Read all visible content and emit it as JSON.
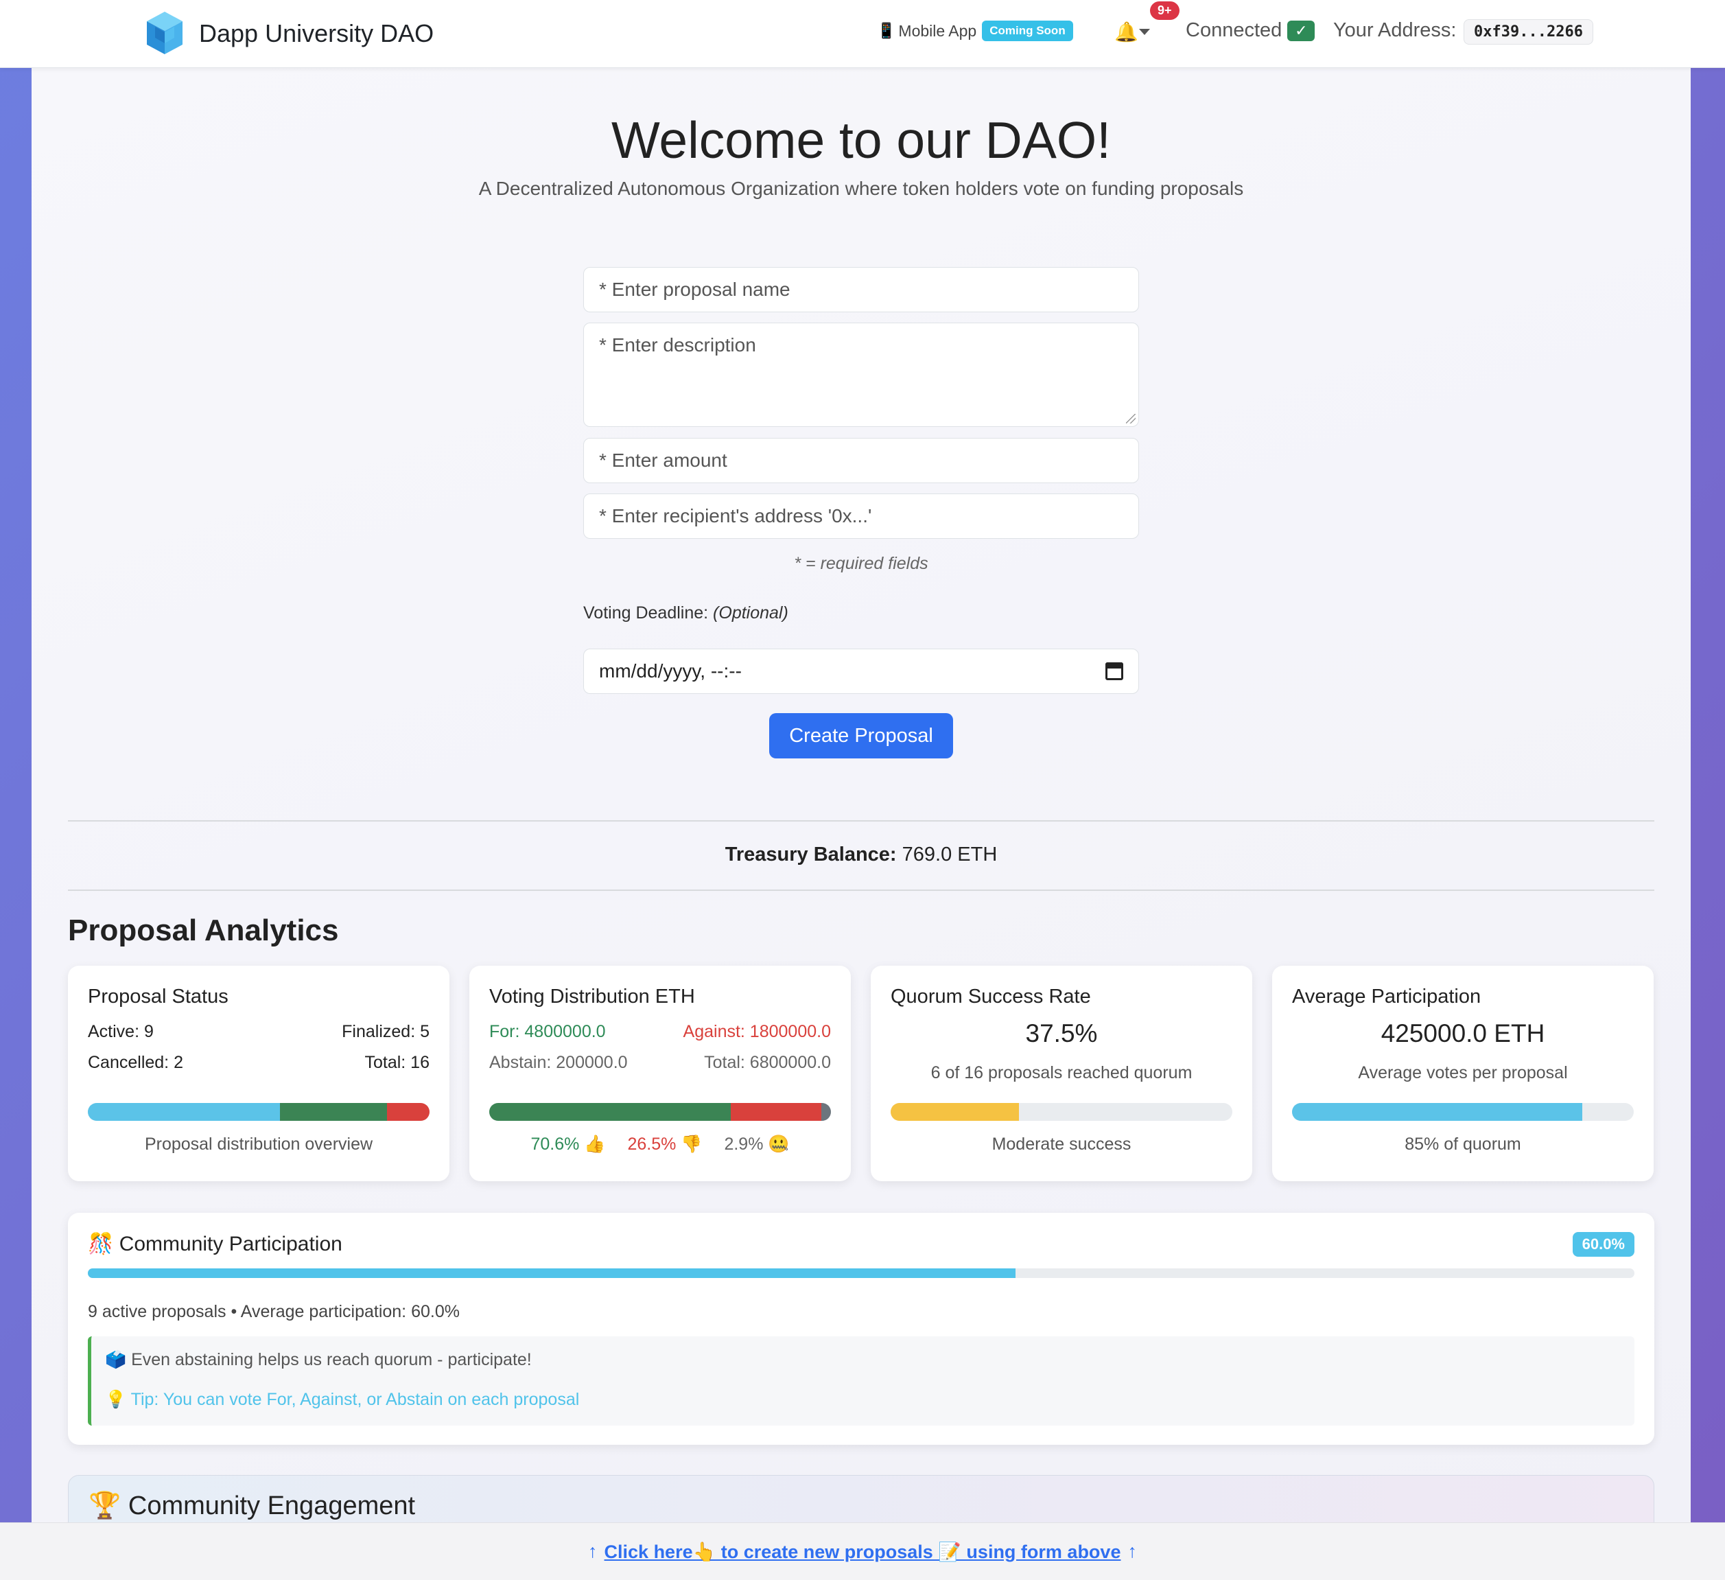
{
  "nav": {
    "brand": "Dapp University DAO",
    "mobile_app": "Mobile App",
    "coming_soon": "Coming Soon",
    "notif_count": "9+",
    "connected": "Connected",
    "check": "✓",
    "address_label": "Your Address:",
    "address": "0xf39...2266"
  },
  "hero": {
    "title": "Welcome to our DAO!",
    "subtitle": "A Decentralized Autonomous Organization where token holders vote on funding proposals"
  },
  "form": {
    "name_placeholder": "* Enter proposal name",
    "description_placeholder": "* Enter description",
    "amount_placeholder": "* Enter amount",
    "recipient_placeholder": "* Enter recipient's address '0x...'",
    "required_note": "* = required fields",
    "deadline_label": "Voting Deadline:",
    "deadline_optional": "(Optional)",
    "date_placeholder": "mm/dd/yyyy, --:--",
    "create_button": "Create Proposal"
  },
  "treasury": {
    "label": "Treasury Balance:",
    "value": "769.0 ETH"
  },
  "analytics": {
    "title": "Proposal Analytics",
    "status": {
      "title": "Proposal Status",
      "active": "Active: 9",
      "finalized": "Finalized: 5",
      "cancelled": "Cancelled: 2",
      "total": "Total: 16",
      "caption": "Proposal distribution overview",
      "distribution": {
        "active": 9,
        "finalized": 5,
        "cancelled": 2,
        "total": 16
      },
      "colors": {
        "active": "#5bc3e8",
        "finalized": "#3b8454",
        "cancelled": "#d9413c"
      }
    },
    "voting": {
      "title": "Voting Distribution ETH",
      "for": "For: 4800000.0",
      "against": "Against: 1800000.0",
      "abstain": "Abstain: 200000.0",
      "total": "Total: 6800000.0",
      "for_pct": "70.6% 👍",
      "against_pct": "26.5% 👎",
      "abstain_pct": "2.9% 🤐",
      "shares": {
        "for": 70.6,
        "against": 26.5,
        "abstain": 2.9
      },
      "colors": {
        "for": "#3b8454",
        "against": "#d9413c",
        "abstain": "#6c757d"
      }
    },
    "quorum": {
      "title": "Quorum Success Rate",
      "value": "37.5%",
      "detail": "6 of 16 proposals reached quorum",
      "caption": "Moderate success",
      "fill_pct": 37.5,
      "color": "#f5c242"
    },
    "participation": {
      "title": "Average Participation",
      "value": "425000.0 ETH",
      "detail": "Average votes per proposal",
      "caption": "85% of quorum",
      "fill_pct": 85,
      "color": "#5bc3e8"
    }
  },
  "community": {
    "title": "🎊 Community Participation",
    "badge": "60.0%",
    "fill_pct": 60,
    "summary": "9 active proposals • Average participation: 60.0%",
    "tip1": "🗳️ Even abstaining helps us reach quorum - participate!",
    "tip2": "💡 Tip: You can vote For, Against, or Abstain on each proposal"
  },
  "engagement": {
    "title": "🏆 Community Engagement"
  },
  "footer": {
    "arrow_left": "↑",
    "link": "Click here👆 to create new proposals 📝 using form above",
    "arrow_right": "↑"
  }
}
